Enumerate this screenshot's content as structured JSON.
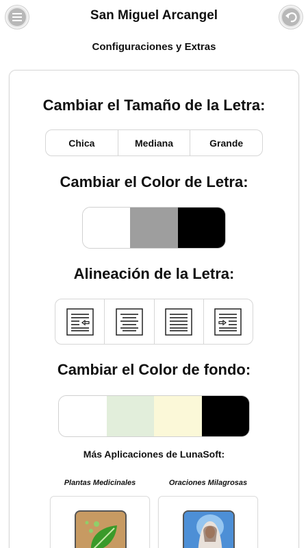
{
  "header": {
    "title": "San Miguel Arcangel",
    "subtitle": "Configuraciones y Extras",
    "menu_icon": "menu-icon",
    "back_icon": "back-arrow-icon"
  },
  "font_size": {
    "heading": "Cambiar el Tamaño de la Letra:",
    "options": [
      "Chica",
      "Mediana",
      "Grande"
    ]
  },
  "font_color": {
    "heading": "Cambiar el Color de Letra:",
    "swatches": [
      "#ffffff",
      "#9e9e9e",
      "#000000"
    ]
  },
  "alignment": {
    "heading": "Alineación de la Letra:",
    "options": [
      "align-left-icon",
      "align-center-icon",
      "align-justify-icon",
      "align-right-icon"
    ]
  },
  "background_color": {
    "heading": "Cambiar el Color de fondo:",
    "swatches": [
      "#ffffff",
      "#e2eedb",
      "#fbf8d8",
      "#000000"
    ]
  },
  "more_apps": {
    "heading": "Más Aplicaciones de LunaSoft:",
    "apps": [
      {
        "label": "Plantas Medicinales",
        "icon": "leaf-app-icon"
      },
      {
        "label": "Oraciones Milagrosas",
        "icon": "virgin-mary-app-icon"
      }
    ]
  }
}
